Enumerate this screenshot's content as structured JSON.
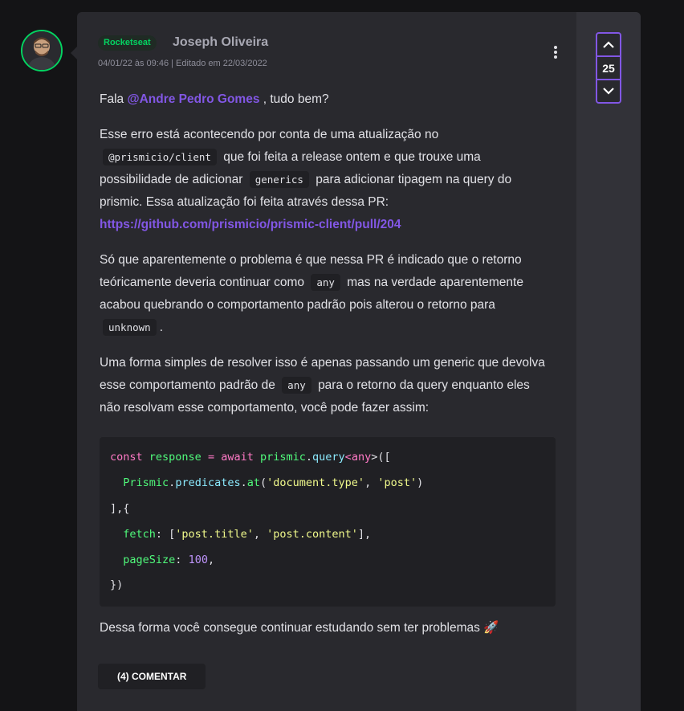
{
  "comment": {
    "badge": "Rocketseat",
    "author": "Joseph Oliveira",
    "meta": "04/01/22 às 09:46 | Editado em 22/03/2022",
    "greeting_prefix": "Fala",
    "mention": "@Andre Pedro Gomes",
    "greeting_suffix": ", tudo bem?",
    "p2_a": "Esse erro está acontecendo por conta de uma atualização no",
    "p2_code1": "@prismicio/client",
    "p2_b": "que foi feita a release ontem e que trouxe uma possibilidade de adicionar",
    "p2_code2": "generics",
    "p2_c": "para adicionar tipagem na query do prismic. Essa atualização foi feita através dessa PR:",
    "p2_link": "https://github.com/prismicio/prismic-client/pull/204",
    "p3_a": "Só que aparentemente o problema é que nessa PR é indicado que o retorno teóricamente deveria continuar como",
    "p3_code1": "any",
    "p3_b": "mas na verdade aparentemente acabou quebrando o comportamento padrão pois alterou o retorno para",
    "p3_code2": "unknown",
    "p3_c": ".",
    "p4_a": "Uma forma simples de resolver isso é apenas passando um generic que devolva esse comportamento padrão de",
    "p4_code1": "any",
    "p4_b": "para o retorno da query enquanto eles não resolvam esse comportamento, você pode fazer assim:",
    "code": {
      "l1_kw": "const",
      "l1_var": "response",
      "l1_eq": " = ",
      "l1_await": "await",
      "l1_obj": "prismic",
      "l1_dot": ".",
      "l1_fn": "query",
      "l1_lt": "<",
      "l1_type": "any",
      "l1_rest": ">([",
      "l2_obj": "Prismic",
      "l2_dot1": ".",
      "l2_prop": "predicates",
      "l2_dot2": ".",
      "l2_fn": "at",
      "l2_open": "(",
      "l2_s1": "'document.type'",
      "l2_comma": ", ",
      "l2_s2": "'post'",
      "l2_close": ")",
      "l3": "],{",
      "l4_key": "fetch",
      "l4_colon": ": [",
      "l4_s1": "'post.title'",
      "l4_comma": ", ",
      "l4_s2": "'post.content'",
      "l4_end": "],",
      "l5_key": "pageSize",
      "l5_colon": ": ",
      "l5_num": "100",
      "l5_end": ",",
      "l6": "})"
    },
    "closing": "Dessa forma você consegue continuar estudando sem ter problemas 🚀",
    "comment_button": "(4) COMENTAR"
  },
  "votes": {
    "count": "25",
    "up_icon": "chevron-up-icon",
    "down_icon": "chevron-down-icon"
  },
  "colors": {
    "accent": "#8257e5",
    "brand_green": "#04d361",
    "card_bg": "#29292e",
    "page_bg": "#141416"
  }
}
